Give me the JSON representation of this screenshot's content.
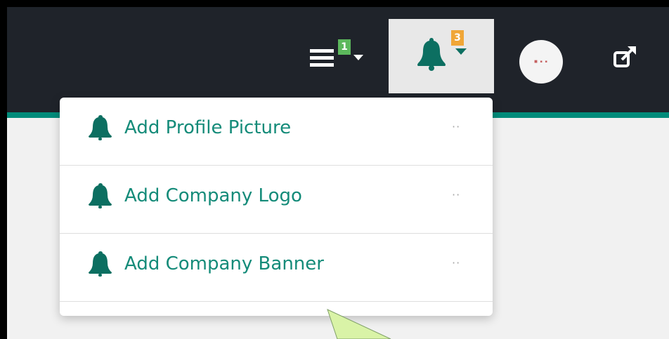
{
  "header": {
    "tasks": {
      "icon": "tasks-list-icon",
      "badge": "1",
      "badge_color": "#5cb85c",
      "caret_icon": "caret-down-icon"
    },
    "notifications": {
      "icon": "bell-icon",
      "badge": "3",
      "badge_color": "#f0a637",
      "caret_icon": "caret-down-icon",
      "active_background": "#e8e8e8"
    },
    "avatar": {
      "icon": "company-logo-avatar"
    },
    "external_link": {
      "icon": "external-link-icon"
    },
    "background": "#1f232a",
    "accent": "#008c7a"
  },
  "notifications_menu": {
    "items": [
      {
        "label": "Add Profile Picture",
        "icon": "bell-icon",
        "meta_icon": "ellipsis-icon"
      },
      {
        "label": "Add Company Logo",
        "icon": "bell-icon",
        "meta_icon": "ellipsis-icon"
      },
      {
        "label": "Add Company Banner",
        "icon": "bell-icon",
        "meta_icon": "ellipsis-icon"
      }
    ],
    "text_color": "#148b79"
  },
  "annotation": {
    "icon": "callout-pointer",
    "color": "#d9f3a7"
  }
}
